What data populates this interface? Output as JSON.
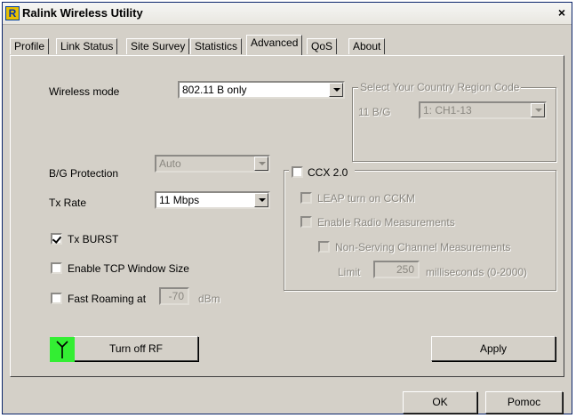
{
  "window": {
    "title": "Ralink Wireless Utility",
    "close_label": "×"
  },
  "tabs": [
    {
      "label": "Profile"
    },
    {
      "label": "Link Status"
    },
    {
      "label": "Site Survey"
    },
    {
      "label": "Statistics"
    },
    {
      "label": "Advanced",
      "active": true
    },
    {
      "label": "QoS"
    },
    {
      "label": "About"
    }
  ],
  "wireless_mode": {
    "label": "Wireless mode",
    "value": "802.11 B only"
  },
  "country_region": {
    "title": "Select Your Country Region Code",
    "band_label": "11 B/G",
    "value": "1: CH1-13",
    "enabled": false
  },
  "bg_protection": {
    "label": "B/G Protection",
    "value": "Auto",
    "enabled": false
  },
  "tx_rate": {
    "label": "Tx Rate",
    "value": "11 Mbps"
  },
  "tx_burst": {
    "label": "Tx BURST",
    "checked": true
  },
  "tcp_window": {
    "label": "Enable TCP Window Size",
    "checked": false
  },
  "fast_roaming": {
    "label": "Fast Roaming at",
    "value": "-70",
    "unit": "dBm",
    "checked": false
  },
  "ccx": {
    "label": "CCX 2.0",
    "checked": false,
    "leap_label": "LEAP turn on CCKM",
    "radio_meas_label": "Enable Radio Measurements",
    "non_serving_label": "Non-Serving Channel Measurements",
    "limit_label": "Limit",
    "limit_value": "250",
    "limit_unit": "milliseconds (0-2000)"
  },
  "rf": {
    "button_label": "Turn off RF",
    "icon": "antenna-icon",
    "icon_color": "#33ee33"
  },
  "apply_label": "Apply",
  "footer": {
    "ok_label": "OK",
    "help_label": "Pomoc"
  }
}
